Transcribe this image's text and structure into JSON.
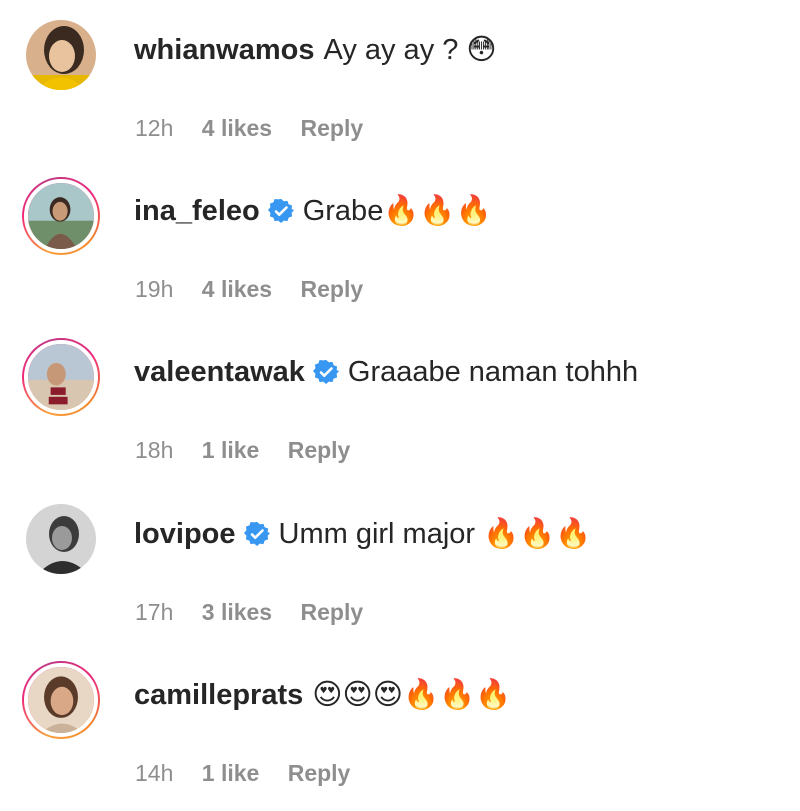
{
  "comments": [
    {
      "username": "whianwamos",
      "verified": false,
      "text": "Ay ay ay ? 😳",
      "time": "12h",
      "likes": "4 likes",
      "reply": "Reply",
      "avatar_icon": "avatar-photo-icon",
      "story_ring": false
    },
    {
      "username": "ina_feleo",
      "verified": true,
      "text": "Grabe🔥🔥🔥",
      "time": "19h",
      "likes": "4 likes",
      "reply": "Reply",
      "avatar_icon": "avatar-photo-icon",
      "story_ring": true
    },
    {
      "username": "valeentawak",
      "verified": true,
      "text": "Graaabe naman tohhh",
      "time": "18h",
      "likes": "1 like",
      "reply": "Reply",
      "avatar_icon": "avatar-photo-icon",
      "story_ring": true
    },
    {
      "username": "lovipoe",
      "verified": true,
      "text": "Umm girl major 🔥🔥🔥",
      "time": "17h",
      "likes": "3 likes",
      "reply": "Reply",
      "avatar_icon": "avatar-photo-icon",
      "story_ring": false
    },
    {
      "username": "camilleprats",
      "verified": false,
      "text": "😍😍😍🔥🔥🔥",
      "time": "14h",
      "likes": "1 like",
      "reply": "Reply",
      "avatar_icon": "avatar-photo-icon",
      "story_ring": true
    }
  ],
  "colors": {
    "text": "#262626",
    "meta": "#8e8e8e",
    "verified_badge": "#3897f0"
  }
}
